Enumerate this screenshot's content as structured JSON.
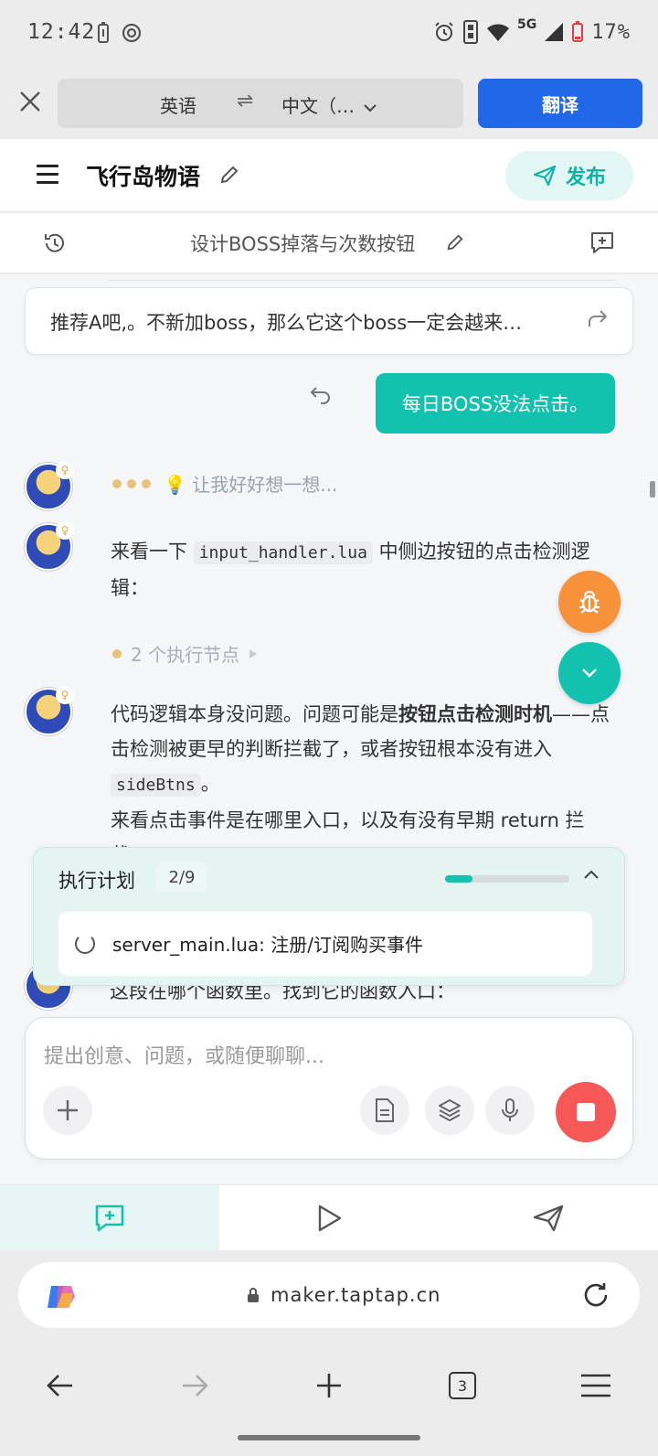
{
  "status_bar": {
    "time": "12:42",
    "network": "5G",
    "battery": "17%"
  },
  "translate_bar": {
    "from_lang": "英语",
    "swap_symbol": "⇌",
    "to_lang": "中文（…",
    "translate_label": "翻译"
  },
  "app_header": {
    "title": "飞行岛物语",
    "publish_label": "发布"
  },
  "conversation": {
    "title": "设计BOSS掉落与次数按钮"
  },
  "chat": {
    "quoted_message": "推荐A吧,。不新加boss，那么它这个boss一定会越来…",
    "user_message": "每日BOSS没法点击。",
    "thinking_text": "💡 让我好好想一想...",
    "msg1_prefix": "来看一下",
    "msg1_code": "input_handler.lua",
    "msg1_suffix": "中侧边按钮的点击检测逻辑：",
    "exec_nodes": "2 个执行节点",
    "msg2_part1": "代码逻辑本身没问题。问题可能是",
    "msg2_bold": "按钮点击检测时机",
    "msg2_part2": "——点击检测被更早的判断拦截了，或者按钮根本没有进入",
    "msg2_code": "sideBtns",
    "msg2_part3": "。",
    "msg2_line2": "来看点击事件是在哪里入口，以及有没有早期 return 拦截：",
    "partial_text": "这段在哪个函数里。找到它的函数入口："
  },
  "plan": {
    "title": "执行计划",
    "count": "2/9",
    "progress_fraction": 0.2222,
    "current_item": "server_main.lua: 注册/订阅购买事件"
  },
  "composer": {
    "placeholder": "提出创意、问题，或随便聊聊..."
  },
  "browser": {
    "url": "maker.taptap.cn",
    "tab_count": "3"
  },
  "colors": {
    "accent_teal": "#12c2ae",
    "translate_blue": "#2168e8",
    "bug_orange": "#f8923a",
    "stop_red": "#f65757"
  }
}
